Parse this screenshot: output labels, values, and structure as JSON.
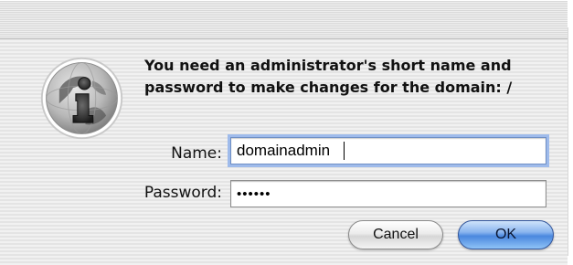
{
  "dialog": {
    "message": "You need an administrator's short name and password to make changes for the domain: /",
    "icon": "info-globe-icon"
  },
  "fields": {
    "name_label": "Name:",
    "name_value": "domainadmin",
    "password_label": "Password:",
    "password_value": "••••••"
  },
  "buttons": {
    "cancel_label": "Cancel",
    "ok_label": "OK"
  },
  "colors": {
    "ok_button": "#4a87de",
    "focus_ring": "#9fbbeb",
    "window_background": "#eeeeee"
  }
}
